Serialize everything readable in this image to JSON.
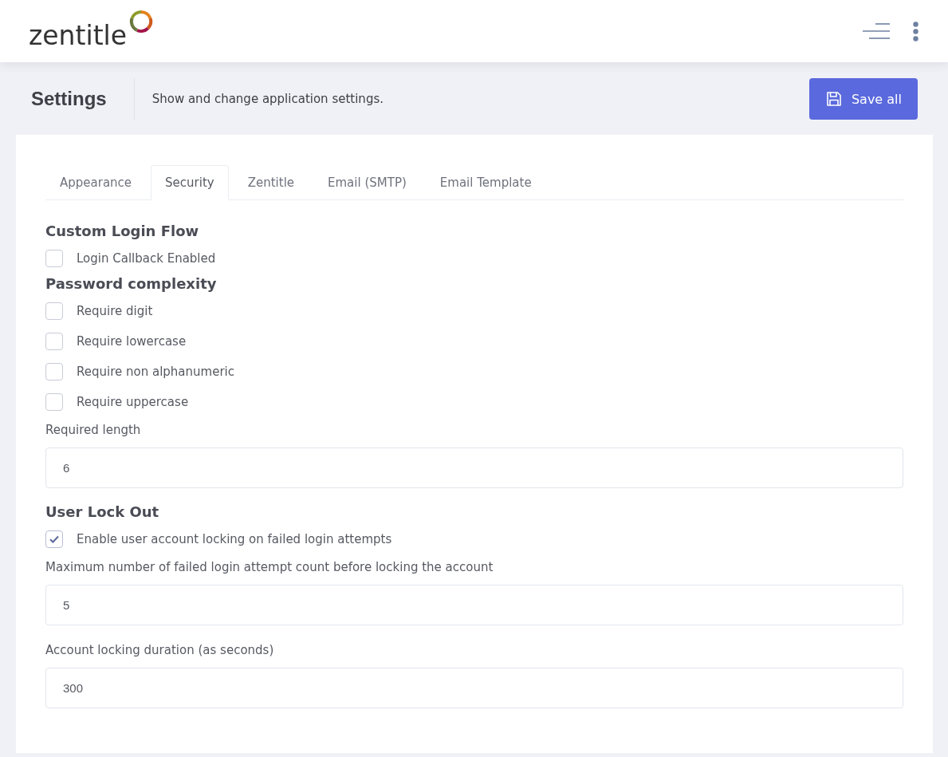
{
  "header": {
    "logo_text": "zentitle"
  },
  "page_header": {
    "title": "Settings",
    "description": "Show and change application settings.",
    "save_button": "Save all"
  },
  "tabs": [
    {
      "label": "Appearance",
      "selected": false
    },
    {
      "label": "Security",
      "selected": true
    },
    {
      "label": "Zentitle",
      "selected": false
    },
    {
      "label": "Email (SMTP)",
      "selected": false
    },
    {
      "label": "Email Template",
      "selected": false
    }
  ],
  "sections": [
    {
      "title": "Custom Login Flow",
      "items": [
        {
          "kind": "checkbox",
          "label": "Login Callback Enabled",
          "checked": false
        }
      ]
    },
    {
      "title": "Password complexity",
      "items": [
        {
          "kind": "checkbox",
          "label": "Require digit",
          "checked": false
        },
        {
          "kind": "checkbox",
          "label": "Require lowercase",
          "checked": false
        },
        {
          "kind": "checkbox",
          "label": "Require non alphanumeric",
          "checked": false
        },
        {
          "kind": "checkbox",
          "label": "Require uppercase",
          "checked": false
        },
        {
          "kind": "field",
          "label": "Required length",
          "value": "6"
        }
      ]
    },
    {
      "title": "User Lock Out",
      "items": [
        {
          "kind": "checkbox",
          "label": "Enable user account locking on failed login attempts",
          "checked": true
        },
        {
          "kind": "field",
          "label": "Maximum number of failed login attempt count before locking the account",
          "value": "5"
        },
        {
          "kind": "field",
          "label": "Account locking duration (as seconds)",
          "value": "300"
        }
      ]
    }
  ]
}
